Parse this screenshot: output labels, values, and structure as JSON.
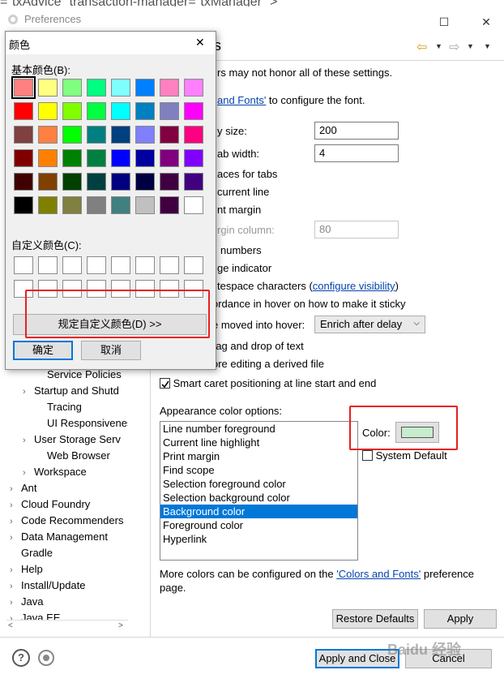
{
  "background_code": "=\"txAdvice\" transaction-manager=\"txManager\" >",
  "preferences": {
    "title": "Preferences",
    "header_title_fragment": "s",
    "nav_back": "⇦",
    "nav_forward": "⇨",
    "notice": "rs may not honor all of these settings.",
    "font_link_fragment": "and Fonts'",
    "font_text": "to configure the font.",
    "history_label": "y size:",
    "history_value": "200",
    "tab_label": "ab width:",
    "tab_value": "4",
    "insert_spaces": "aces for tabs",
    "highlight_line": "current line",
    "print_margin": "nt margin",
    "margin_column_label": "rgin column:",
    "margin_column_value": "80",
    "line_numbers": "numbers",
    "range_indicator": "ge indicator",
    "whitespace_text": "tespace characters (",
    "whitespace_link": "configure visibility",
    "whitespace_close": ")",
    "affordance": "ordance in hover on how to make it sticky",
    "hover_label": "e moved into hover:",
    "hover_value": "Enrich after delay",
    "drag_drop": "rag and drop of text",
    "warn_derived": "ore editing a derived file",
    "smart_caret": "Smart caret positioning at line start and end",
    "appearance_label": "Appearance color options:",
    "color_items": [
      "Line number foreground",
      "Current line highlight",
      "Print margin",
      "Find scope",
      "Selection foreground color",
      "Selection background color",
      "Background color",
      "Foreground color",
      "Hyperlink"
    ],
    "selected_color_item": "Background color",
    "color_label": "Color:",
    "color_swatch": "#c7edcc",
    "system_default": "System Default",
    "more_colors_text": "More colors can be configured on the",
    "more_colors_link": "'Colors and Fonts'",
    "more_colors_suffix": "preference",
    "more_colors_page": "page.",
    "restore_defaults": "Restore Defaults",
    "apply": "Apply",
    "apply_close": "Apply and Close",
    "cancel": "Cancel",
    "watermark": "Baidu 经验",
    "tree": [
      {
        "label": "Service Policies",
        "indent": 2,
        "expand": false
      },
      {
        "label": "Startup and Shutd",
        "indent": 1,
        "expand": true
      },
      {
        "label": "Tracing",
        "indent": 2,
        "expand": false
      },
      {
        "label": "UI Responsivenes",
        "indent": 2,
        "expand": false
      },
      {
        "label": "User Storage Serv",
        "indent": 1,
        "expand": true
      },
      {
        "label": "Web Browser",
        "indent": 2,
        "expand": false
      },
      {
        "label": "Workspace",
        "indent": 1,
        "expand": true
      },
      {
        "label": "Ant",
        "indent": 0,
        "expand": true
      },
      {
        "label": "Cloud Foundry",
        "indent": 0,
        "expand": true
      },
      {
        "label": "Code Recommenders",
        "indent": 0,
        "expand": true
      },
      {
        "label": "Data Management",
        "indent": 0,
        "expand": true
      },
      {
        "label": "Gradle",
        "indent": 0,
        "expand": false
      },
      {
        "label": "Help",
        "indent": 0,
        "expand": true
      },
      {
        "label": "Install/Update",
        "indent": 0,
        "expand": true
      },
      {
        "label": "Java",
        "indent": 0,
        "expand": true
      },
      {
        "label": "Java EE",
        "indent": 0,
        "expand": true
      }
    ]
  },
  "color_dialog": {
    "title": "颜色",
    "close": "✕",
    "basic_label": "基本颜色(B):",
    "custom_label": "自定义颜色(C):",
    "define_custom": "规定自定义颜色(D) >>",
    "ok": "确定",
    "cancel": "取消",
    "basic_colors": [
      "#ff8080",
      "#ffff80",
      "#80ff80",
      "#00ff80",
      "#80ffff",
      "#0080ff",
      "#ff80c0",
      "#ff80ff",
      "#ff0000",
      "#ffff00",
      "#80ff00",
      "#00ff40",
      "#00ffff",
      "#0080c0",
      "#8080c0",
      "#ff00ff",
      "#804040",
      "#ff8040",
      "#00ff00",
      "#008080",
      "#004080",
      "#8080ff",
      "#800040",
      "#ff0080",
      "#800000",
      "#ff8000",
      "#008000",
      "#008040",
      "#0000ff",
      "#0000a0",
      "#800080",
      "#8000ff",
      "#400000",
      "#804000",
      "#004000",
      "#004040",
      "#000080",
      "#000040",
      "#400040",
      "#400080",
      "#000000",
      "#808000",
      "#808040",
      "#808080",
      "#408080",
      "#c0c0c0",
      "#400040",
      "#ffffff"
    ]
  }
}
